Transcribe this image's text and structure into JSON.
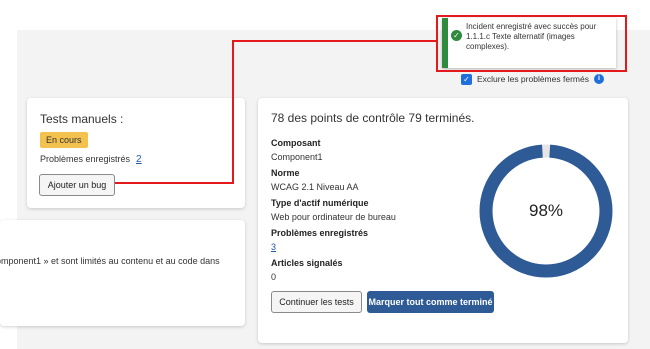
{
  "toast": {
    "message": "Incident enregistré avec succès pour 1.1.1.c Texte alternatif (images complexes).",
    "icon": "check-circle-icon"
  },
  "filter": {
    "exclude_label": "Exclure les problèmes fermés",
    "checked": true
  },
  "manual_tests": {
    "title": "Tests manuels :",
    "status_badge": "En cours",
    "issues_label": "Problèmes enregistrés",
    "issues_count": "2",
    "add_bug_button": "Ajouter un bug"
  },
  "component_note": {
    "text": "omponent1 » et sont limités au contenu et au code dans"
  },
  "progress": {
    "title": "78 des points de contrôle 79 terminés.",
    "fields": [
      {
        "label": "Composant",
        "value": "Component1"
      },
      {
        "label": "Norme",
        "value": "WCAG 2.1 Niveau AA"
      },
      {
        "label": "Type d'actif numérique",
        "value": "Web pour ordinateur de bureau"
      },
      {
        "label": "Problèmes enregistrés",
        "value": "3"
      },
      {
        "label": "Articles signalés",
        "value": "0"
      }
    ],
    "percent_label": "98%",
    "percent_value": 98,
    "continue_button": "Continuer les tests",
    "complete_button": "Marquer tout comme terminé"
  },
  "colors": {
    "accent": "#2e5a96",
    "donut": "#2e5a96",
    "success": "#2f8a3e",
    "badge": "#f2c14e",
    "annotation": "#e3191b"
  }
}
